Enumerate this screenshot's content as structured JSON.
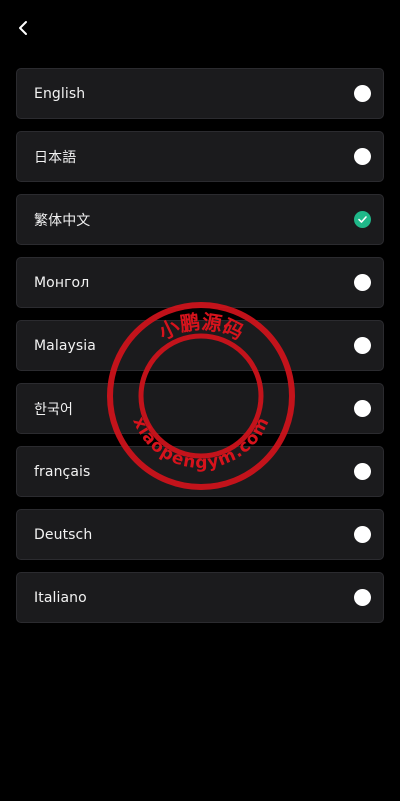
{
  "header": {
    "back_icon": "chevron-left-icon"
  },
  "languages": [
    {
      "label": "English",
      "selected": false
    },
    {
      "label": "日本語",
      "selected": false
    },
    {
      "label": "繁体中文",
      "selected": true
    },
    {
      "label": "Монгол",
      "selected": false
    },
    {
      "label": "Malaysia",
      "selected": false
    },
    {
      "label": "한국어",
      "selected": false
    },
    {
      "label": "français",
      "selected": false
    },
    {
      "label": "Deutsch",
      "selected": false
    },
    {
      "label": "Italiano",
      "selected": false
    }
  ],
  "watermark": {
    "top_text": "小鹏源码",
    "bottom_text": "xiaopengym.com"
  },
  "colors": {
    "background": "#000000",
    "card": "#1b1b1d",
    "selected": "#1fb889",
    "watermark": "#d6131c"
  }
}
